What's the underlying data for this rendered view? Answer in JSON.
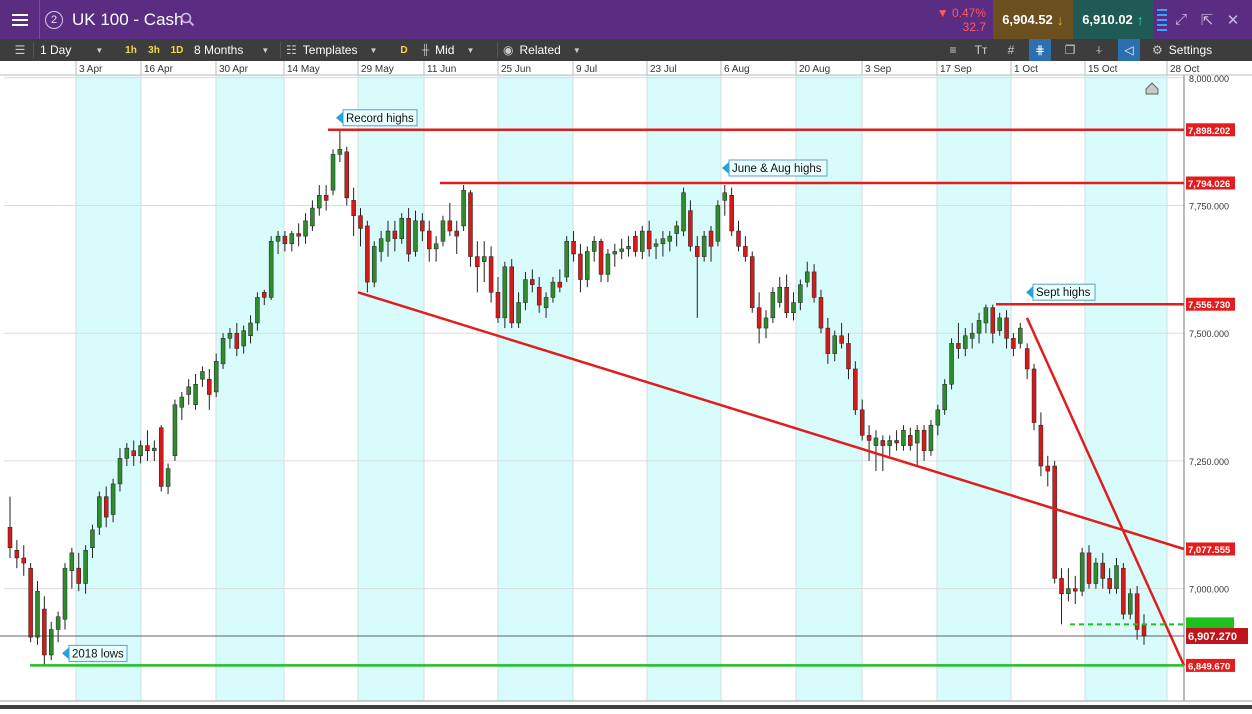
{
  "header": {
    "menu_icon": "hamburger-icon",
    "count_badge": "2",
    "title": "UK 100 - Cash",
    "search_icon": "search-icon",
    "change_percent": "▼ 0.47%",
    "change_points": "32.7",
    "sell_price": "6,904.52",
    "buy_price": "6,910.02",
    "colors": {
      "bar": "#5a2c82",
      "sell": "#6b4f1e",
      "buy": "#1f5a55",
      "down": "#ff5a5a"
    }
  },
  "toolbar": {
    "timeframe": "1 Day",
    "tf_1h": "1h",
    "tf_3h": "3h",
    "tf_1d": "1D",
    "range": "8 Months",
    "templates": "Templates",
    "d_badge": "D",
    "price_type": "Mid",
    "related": "Related",
    "settings": "Settings"
  },
  "chart_data": {
    "type": "candlestick",
    "x_dates": [
      "3 Apr",
      "16 Apr",
      "30 Apr",
      "14 May",
      "29 May",
      "11 Jun",
      "25 Jun",
      "9 Jul",
      "23 Jul",
      "6 Aug",
      "20 Aug",
      "3 Sep",
      "17 Sep",
      "1 Oct",
      "15 Oct",
      "28 Oct"
    ],
    "y_ticks": [
      "8,000.000",
      "7,750.000",
      "7,500.000",
      "7,250.000",
      "7,000.000"
    ],
    "y_tick_values": [
      8000,
      7750,
      7500,
      7250,
      7000
    ],
    "ylim": [
      6780,
      8025
    ],
    "price_labels": [
      {
        "text": "7,898.202",
        "value": 7898.202,
        "color": "#e11d1d"
      },
      {
        "text": "7,794.026",
        "value": 7794.026,
        "color": "#e11d1d"
      },
      {
        "text": "7,556.730",
        "value": 7556.73,
        "color": "#e11d1d"
      },
      {
        "text": "7,077.555",
        "value": 7077.555,
        "color": "#e11d1d"
      },
      {
        "text": "6,907.270",
        "value": 6907.27,
        "color": "#c0141c"
      },
      {
        "text": "6,849.670",
        "value": 6849.67,
        "color": "#e11d1d"
      }
    ],
    "annotations": [
      "Record highs",
      "June & Aug highs",
      "Sept highs",
      "2018 lows"
    ],
    "candles": [
      {
        "o": 7120,
        "h": 7180,
        "l": 7060,
        "c": 7080
      },
      {
        "o": 7075,
        "h": 7095,
        "l": 7040,
        "c": 7060
      },
      {
        "o": 7060,
        "h": 7085,
        "l": 7025,
        "c": 7050
      },
      {
        "o": 7040,
        "h": 7050,
        "l": 6895,
        "c": 6905
      },
      {
        "o": 6905,
        "h": 7015,
        "l": 6890,
        "c": 6995
      },
      {
        "o": 6960,
        "h": 6985,
        "l": 6850,
        "c": 6870
      },
      {
        "o": 6870,
        "h": 6935,
        "l": 6860,
        "c": 6920
      },
      {
        "o": 6920,
        "h": 6955,
        "l": 6895,
        "c": 6945
      },
      {
        "o": 6940,
        "h": 7050,
        "l": 6920,
        "c": 7040
      },
      {
        "o": 7035,
        "h": 7080,
        "l": 7000,
        "c": 7070
      },
      {
        "o": 7040,
        "h": 7070,
        "l": 6995,
        "c": 7010
      },
      {
        "o": 7010,
        "h": 7085,
        "l": 6990,
        "c": 7075
      },
      {
        "o": 7080,
        "h": 7125,
        "l": 7060,
        "c": 7115
      },
      {
        "o": 7120,
        "h": 7190,
        "l": 7105,
        "c": 7180
      },
      {
        "o": 7180,
        "h": 7200,
        "l": 7120,
        "c": 7140
      },
      {
        "o": 7145,
        "h": 7215,
        "l": 7130,
        "c": 7205
      },
      {
        "o": 7205,
        "h": 7275,
        "l": 7190,
        "c": 7255
      },
      {
        "o": 7255,
        "h": 7285,
        "l": 7240,
        "c": 7275
      },
      {
        "o": 7270,
        "h": 7290,
        "l": 7240,
        "c": 7260
      },
      {
        "o": 7260,
        "h": 7290,
        "l": 7245,
        "c": 7280
      },
      {
        "o": 7280,
        "h": 7310,
        "l": 7250,
        "c": 7270
      },
      {
        "o": 7270,
        "h": 7290,
        "l": 7250,
        "c": 7275
      },
      {
        "o": 7315,
        "h": 7320,
        "l": 7190,
        "c": 7200
      },
      {
        "o": 7200,
        "h": 7245,
        "l": 7185,
        "c": 7235
      },
      {
        "o": 7260,
        "h": 7370,
        "l": 7250,
        "c": 7360
      },
      {
        "o": 7355,
        "h": 7385,
        "l": 7330,
        "c": 7375
      },
      {
        "o": 7380,
        "h": 7410,
        "l": 7360,
        "c": 7395
      },
      {
        "o": 7360,
        "h": 7420,
        "l": 7350,
        "c": 7400
      },
      {
        "o": 7410,
        "h": 7435,
        "l": 7395,
        "c": 7425
      },
      {
        "o": 7410,
        "h": 7430,
        "l": 7350,
        "c": 7380
      },
      {
        "o": 7385,
        "h": 7460,
        "l": 7375,
        "c": 7445
      },
      {
        "o": 7440,
        "h": 7500,
        "l": 7430,
        "c": 7490
      },
      {
        "o": 7490,
        "h": 7510,
        "l": 7470,
        "c": 7500
      },
      {
        "o": 7500,
        "h": 7520,
        "l": 7455,
        "c": 7470
      },
      {
        "o": 7475,
        "h": 7515,
        "l": 7460,
        "c": 7505
      },
      {
        "o": 7495,
        "h": 7535,
        "l": 7480,
        "c": 7520
      },
      {
        "o": 7520,
        "h": 7580,
        "l": 7505,
        "c": 7570
      },
      {
        "o": 7580,
        "h": 7585,
        "l": 7555,
        "c": 7570
      },
      {
        "o": 7570,
        "h": 7690,
        "l": 7565,
        "c": 7680
      },
      {
        "o": 7680,
        "h": 7700,
        "l": 7655,
        "c": 7690
      },
      {
        "o": 7690,
        "h": 7700,
        "l": 7660,
        "c": 7675
      },
      {
        "o": 7675,
        "h": 7700,
        "l": 7660,
        "c": 7695
      },
      {
        "o": 7695,
        "h": 7715,
        "l": 7670,
        "c": 7690
      },
      {
        "o": 7690,
        "h": 7735,
        "l": 7675,
        "c": 7720
      },
      {
        "o": 7710,
        "h": 7760,
        "l": 7700,
        "c": 7745
      },
      {
        "o": 7745,
        "h": 7790,
        "l": 7730,
        "c": 7770
      },
      {
        "o": 7770,
        "h": 7790,
        "l": 7740,
        "c": 7760
      },
      {
        "o": 7780,
        "h": 7860,
        "l": 7770,
        "c": 7850
      },
      {
        "o": 7850,
        "h": 7898,
        "l": 7835,
        "c": 7860
      },
      {
        "o": 7855,
        "h": 7865,
        "l": 7750,
        "c": 7765
      },
      {
        "o": 7760,
        "h": 7785,
        "l": 7690,
        "c": 7730
      },
      {
        "o": 7730,
        "h": 7745,
        "l": 7670,
        "c": 7705
      },
      {
        "o": 7710,
        "h": 7720,
        "l": 7580,
        "c": 7600
      },
      {
        "o": 7600,
        "h": 7680,
        "l": 7590,
        "c": 7670
      },
      {
        "o": 7660,
        "h": 7700,
        "l": 7640,
        "c": 7685
      },
      {
        "o": 7680,
        "h": 7720,
        "l": 7650,
        "c": 7700
      },
      {
        "o": 7700,
        "h": 7720,
        "l": 7660,
        "c": 7685
      },
      {
        "o": 7685,
        "h": 7735,
        "l": 7675,
        "c": 7725
      },
      {
        "o": 7725,
        "h": 7745,
        "l": 7640,
        "c": 7655
      },
      {
        "o": 7660,
        "h": 7740,
        "l": 7650,
        "c": 7720
      },
      {
        "o": 7720,
        "h": 7735,
        "l": 7680,
        "c": 7700
      },
      {
        "o": 7700,
        "h": 7720,
        "l": 7640,
        "c": 7665
      },
      {
        "o": 7665,
        "h": 7690,
        "l": 7640,
        "c": 7675
      },
      {
        "o": 7680,
        "h": 7730,
        "l": 7670,
        "c": 7720
      },
      {
        "o": 7720,
        "h": 7755,
        "l": 7690,
        "c": 7700
      },
      {
        "o": 7700,
        "h": 7720,
        "l": 7655,
        "c": 7690
      },
      {
        "o": 7710,
        "h": 7790,
        "l": 7700,
        "c": 7780
      },
      {
        "o": 7775,
        "h": 7780,
        "l": 7630,
        "c": 7650
      },
      {
        "o": 7650,
        "h": 7680,
        "l": 7580,
        "c": 7630
      },
      {
        "o": 7640,
        "h": 7680,
        "l": 7600,
        "c": 7650
      },
      {
        "o": 7650,
        "h": 7670,
        "l": 7560,
        "c": 7580
      },
      {
        "o": 7580,
        "h": 7610,
        "l": 7520,
        "c": 7530
      },
      {
        "o": 7530,
        "h": 7640,
        "l": 7510,
        "c": 7630
      },
      {
        "o": 7630,
        "h": 7645,
        "l": 7510,
        "c": 7520
      },
      {
        "o": 7520,
        "h": 7580,
        "l": 7510,
        "c": 7560
      },
      {
        "o": 7560,
        "h": 7620,
        "l": 7545,
        "c": 7605
      },
      {
        "o": 7605,
        "h": 7625,
        "l": 7580,
        "c": 7595
      },
      {
        "o": 7590,
        "h": 7610,
        "l": 7540,
        "c": 7555
      },
      {
        "o": 7550,
        "h": 7580,
        "l": 7530,
        "c": 7570
      },
      {
        "o": 7570,
        "h": 7610,
        "l": 7560,
        "c": 7600
      },
      {
        "o": 7600,
        "h": 7625,
        "l": 7580,
        "c": 7590
      },
      {
        "o": 7610,
        "h": 7690,
        "l": 7600,
        "c": 7680
      },
      {
        "o": 7680,
        "h": 7700,
        "l": 7640,
        "c": 7655
      },
      {
        "o": 7655,
        "h": 7675,
        "l": 7580,
        "c": 7605
      },
      {
        "o": 7605,
        "h": 7670,
        "l": 7590,
        "c": 7660
      },
      {
        "o": 7660,
        "h": 7690,
        "l": 7640,
        "c": 7680
      },
      {
        "o": 7680,
        "h": 7685,
        "l": 7600,
        "c": 7615
      },
      {
        "o": 7615,
        "h": 7665,
        "l": 7600,
        "c": 7655
      },
      {
        "o": 7655,
        "h": 7675,
        "l": 7630,
        "c": 7660
      },
      {
        "o": 7660,
        "h": 7685,
        "l": 7645,
        "c": 7665
      },
      {
        "o": 7665,
        "h": 7690,
        "l": 7650,
        "c": 7670
      },
      {
        "o": 7690,
        "h": 7700,
        "l": 7650,
        "c": 7660
      },
      {
        "o": 7660,
        "h": 7710,
        "l": 7645,
        "c": 7700
      },
      {
        "o": 7700,
        "h": 7720,
        "l": 7650,
        "c": 7665
      },
      {
        "o": 7670,
        "h": 7685,
        "l": 7645,
        "c": 7675
      },
      {
        "o": 7675,
        "h": 7700,
        "l": 7650,
        "c": 7685
      },
      {
        "o": 7680,
        "h": 7700,
        "l": 7660,
        "c": 7690
      },
      {
        "o": 7695,
        "h": 7720,
        "l": 7670,
        "c": 7710
      },
      {
        "o": 7700,
        "h": 7785,
        "l": 7690,
        "c": 7775
      },
      {
        "o": 7740,
        "h": 7760,
        "l": 7660,
        "c": 7670
      },
      {
        "o": 7670,
        "h": 7690,
        "l": 7530,
        "c": 7650
      },
      {
        "o": 7650,
        "h": 7700,
        "l": 7640,
        "c": 7690
      },
      {
        "o": 7700,
        "h": 7710,
        "l": 7640,
        "c": 7670
      },
      {
        "o": 7680,
        "h": 7760,
        "l": 7670,
        "c": 7750
      },
      {
        "o": 7760,
        "h": 7790,
        "l": 7730,
        "c": 7775
      },
      {
        "o": 7770,
        "h": 7785,
        "l": 7690,
        "c": 7700
      },
      {
        "o": 7700,
        "h": 7720,
        "l": 7660,
        "c": 7670
      },
      {
        "o": 7670,
        "h": 7690,
        "l": 7640,
        "c": 7650
      },
      {
        "o": 7650,
        "h": 7660,
        "l": 7540,
        "c": 7550
      },
      {
        "o": 7550,
        "h": 7580,
        "l": 7480,
        "c": 7510
      },
      {
        "o": 7510,
        "h": 7545,
        "l": 7490,
        "c": 7530
      },
      {
        "o": 7530,
        "h": 7590,
        "l": 7520,
        "c": 7580
      },
      {
        "o": 7560,
        "h": 7610,
        "l": 7550,
        "c": 7590
      },
      {
        "o": 7590,
        "h": 7615,
        "l": 7530,
        "c": 7540
      },
      {
        "o": 7540,
        "h": 7580,
        "l": 7525,
        "c": 7560
      },
      {
        "o": 7560,
        "h": 7605,
        "l": 7545,
        "c": 7595
      },
      {
        "o": 7600,
        "h": 7640,
        "l": 7590,
        "c": 7620
      },
      {
        "o": 7620,
        "h": 7635,
        "l": 7560,
        "c": 7570
      },
      {
        "o": 7570,
        "h": 7585,
        "l": 7500,
        "c": 7510
      },
      {
        "o": 7510,
        "h": 7530,
        "l": 7440,
        "c": 7460
      },
      {
        "o": 7460,
        "h": 7505,
        "l": 7445,
        "c": 7495
      },
      {
        "o": 7495,
        "h": 7520,
        "l": 7470,
        "c": 7480
      },
      {
        "o": 7480,
        "h": 7500,
        "l": 7410,
        "c": 7430
      },
      {
        "o": 7430,
        "h": 7445,
        "l": 7340,
        "c": 7350
      },
      {
        "o": 7350,
        "h": 7370,
        "l": 7290,
        "c": 7300
      },
      {
        "o": 7300,
        "h": 7320,
        "l": 7250,
        "c": 7290
      },
      {
        "o": 7280,
        "h": 7310,
        "l": 7230,
        "c": 7295
      },
      {
        "o": 7290,
        "h": 7300,
        "l": 7230,
        "c": 7280
      },
      {
        "o": 7280,
        "h": 7300,
        "l": 7260,
        "c": 7290
      },
      {
        "o": 7290,
        "h": 7310,
        "l": 7270,
        "c": 7285
      },
      {
        "o": 7280,
        "h": 7320,
        "l": 7270,
        "c": 7310
      },
      {
        "o": 7300,
        "h": 7315,
        "l": 7270,
        "c": 7280
      },
      {
        "o": 7285,
        "h": 7320,
        "l": 7240,
        "c": 7310
      },
      {
        "o": 7310,
        "h": 7320,
        "l": 7250,
        "c": 7270
      },
      {
        "o": 7270,
        "h": 7330,
        "l": 7260,
        "c": 7320
      },
      {
        "o": 7320,
        "h": 7360,
        "l": 7300,
        "c": 7350
      },
      {
        "o": 7350,
        "h": 7410,
        "l": 7340,
        "c": 7400
      },
      {
        "o": 7400,
        "h": 7490,
        "l": 7390,
        "c": 7480
      },
      {
        "o": 7480,
        "h": 7520,
        "l": 7450,
        "c": 7470
      },
      {
        "o": 7470,
        "h": 7510,
        "l": 7455,
        "c": 7495
      },
      {
        "o": 7490,
        "h": 7520,
        "l": 7470,
        "c": 7500
      },
      {
        "o": 7500,
        "h": 7540,
        "l": 7480,
        "c": 7525
      },
      {
        "o": 7520,
        "h": 7556,
        "l": 7500,
        "c": 7550
      },
      {
        "o": 7550,
        "h": 7556,
        "l": 7480,
        "c": 7500
      },
      {
        "o": 7505,
        "h": 7540,
        "l": 7495,
        "c": 7530
      },
      {
        "o": 7530,
        "h": 7545,
        "l": 7470,
        "c": 7490
      },
      {
        "o": 7490,
        "h": 7500,
        "l": 7455,
        "c": 7470
      },
      {
        "o": 7480,
        "h": 7520,
        "l": 7470,
        "c": 7510
      },
      {
        "o": 7470,
        "h": 7480,
        "l": 7410,
        "c": 7430
      },
      {
        "o": 7430,
        "h": 7440,
        "l": 7310,
        "c": 7325
      },
      {
        "o": 7320,
        "h": 7345,
        "l": 7220,
        "c": 7240
      },
      {
        "o": 7240,
        "h": 7260,
        "l": 7200,
        "c": 7230
      },
      {
        "o": 7240,
        "h": 7250,
        "l": 7010,
        "c": 7020
      },
      {
        "o": 7020,
        "h": 7040,
        "l": 6930,
        "c": 6990
      },
      {
        "o": 6990,
        "h": 7040,
        "l": 6975,
        "c": 7000
      },
      {
        "o": 7000,
        "h": 7025,
        "l": 6970,
        "c": 6995
      },
      {
        "o": 6995,
        "h": 7080,
        "l": 6985,
        "c": 7070
      },
      {
        "o": 7070,
        "h": 7085,
        "l": 7000,
        "c": 7010
      },
      {
        "o": 7010,
        "h": 7060,
        "l": 7000,
        "c": 7050
      },
      {
        "o": 7050,
        "h": 7070,
        "l": 7000,
        "c": 7020
      },
      {
        "o": 7020,
        "h": 7040,
        "l": 6990,
        "c": 7000
      },
      {
        "o": 7000,
        "h": 7060,
        "l": 6990,
        "c": 7045
      },
      {
        "o": 7040,
        "h": 7050,
        "l": 6940,
        "c": 6950
      },
      {
        "o": 6950,
        "h": 7000,
        "l": 6940,
        "c": 6990
      },
      {
        "o": 6990,
        "h": 7005,
        "l": 6900,
        "c": 6920
      },
      {
        "o": 6930,
        "h": 6950,
        "l": 6890,
        "c": 6907
      }
    ]
  }
}
